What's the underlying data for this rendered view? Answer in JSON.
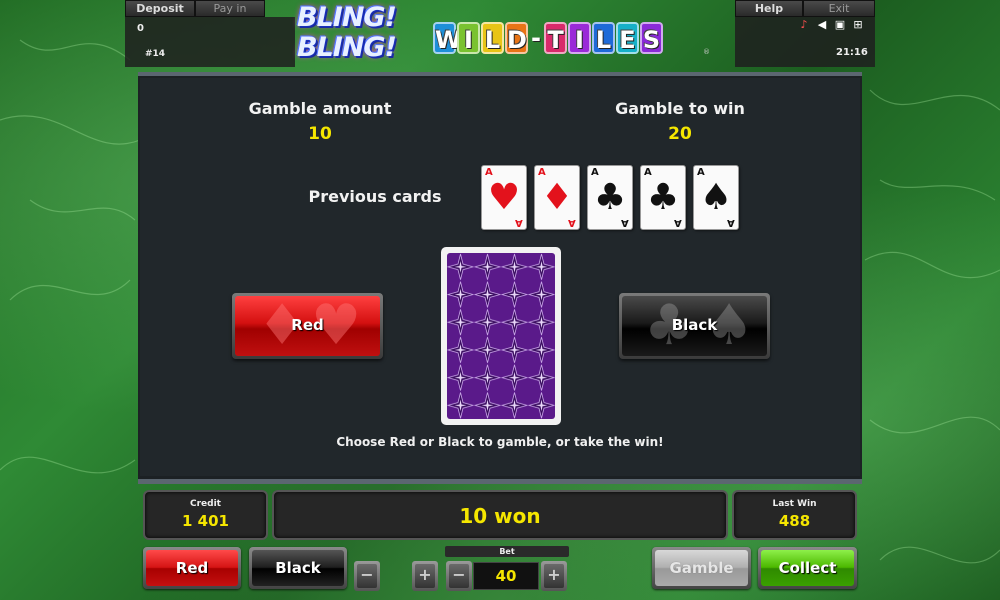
{
  "topbar": {
    "deposit_label": "Deposit",
    "payin_label": "Pay in",
    "help_label": "Help",
    "exit_label": "Exit",
    "balance_counter": "0",
    "game_number": "#14",
    "clock": "21:16"
  },
  "logo": {
    "line1": "BLING!",
    "line2": "BLING!",
    "wild_letters": [
      "W",
      "I",
      "L",
      "D",
      "-",
      "T",
      "I",
      "L",
      "E",
      "S"
    ],
    "registered": "®"
  },
  "gamble": {
    "amount_label": "Gamble amount",
    "amount_value": "10",
    "to_win_label": "Gamble to win",
    "to_win_value": "20",
    "previous_label": "Previous cards",
    "previous_cards": [
      {
        "rank": "A",
        "suit": "♥",
        "color": "red"
      },
      {
        "rank": "A",
        "suit": "♦",
        "color": "red"
      },
      {
        "rank": "A",
        "suit": "♣",
        "color": "black"
      },
      {
        "rank": "A",
        "suit": "♣",
        "color": "black"
      },
      {
        "rank": "A",
        "suit": "♠",
        "color": "black"
      }
    ],
    "red_button": "Red",
    "black_button": "Black",
    "hint": "Choose Red or Black to gamble, or take the win!"
  },
  "displays": {
    "credit_label": "Credit",
    "credit_value": "1 401",
    "won_text": "10 won",
    "last_win_label": "Last Win",
    "last_win_value": "488"
  },
  "controls": {
    "red_label": "Red",
    "black_label": "Black",
    "minus_symbol": "−",
    "plus_symbol": "+",
    "bet_label": "Bet",
    "bet_value": "40",
    "gamble_label": "Gamble",
    "collect_label": "Collect"
  },
  "colors": {
    "highlight_yellow": "#f5e600",
    "card_red": "#e3121c",
    "card_back_purple": "#5a1a8a"
  },
  "icons": [
    "sound-off-icon",
    "speaker-icon",
    "fullscreen-icon",
    "settings-icon"
  ]
}
